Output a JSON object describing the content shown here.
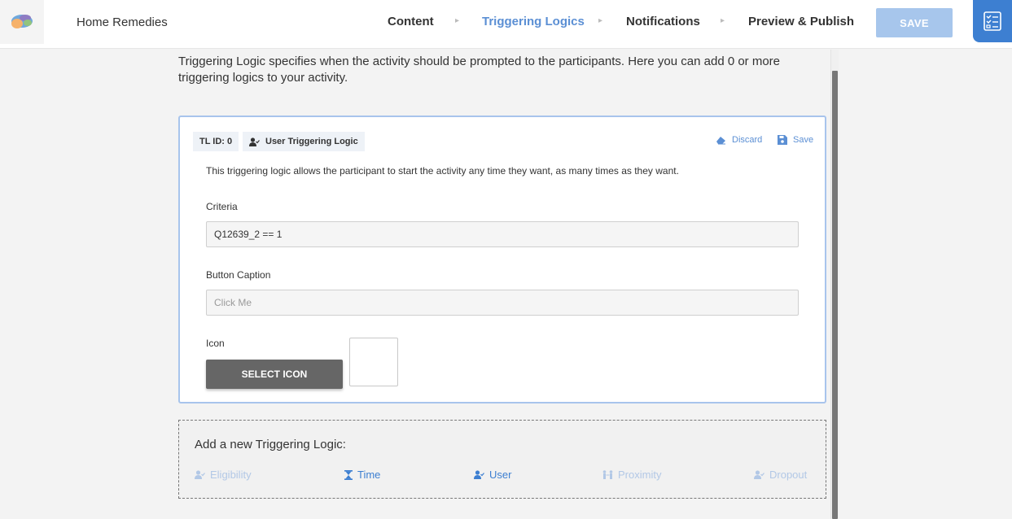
{
  "header": {
    "activity_title": "Home Remedies",
    "steps": [
      {
        "label": "Content",
        "active": false
      },
      {
        "label": "Triggering Logics",
        "active": true
      },
      {
        "label": "Notifications",
        "active": false
      },
      {
        "label": "Preview & Publish",
        "active": false
      }
    ],
    "save_label": "SAVE",
    "colors": {
      "accent": "#3d7fd1",
      "active_step": "#5b8fd4",
      "save_disabled": "#a7c6ec"
    }
  },
  "intro_text": "Triggering Logic specifies when the activity should be prompted to the participants. Here you can add 0 or more triggering logics to your activity.",
  "triggering_logic": {
    "id_label": "TL ID: 0",
    "type_label": "User Triggering Logic",
    "type_icon": "user-check-icon",
    "discard_label": "Discard",
    "save_label": "Save",
    "description": "This triggering logic allows the participant to start the activity any time they want, as many times as they want.",
    "criteria_label": "Criteria",
    "criteria_value": "Q12639_2 == 1",
    "button_caption_label": "Button Caption",
    "button_caption_placeholder": "Click Me",
    "icon_label": "Icon",
    "select_icon_label": "SELECT ICON"
  },
  "add_new": {
    "title": "Add a new Triggering Logic:",
    "options": [
      {
        "label": "Eligibility",
        "icon": "user-check-icon",
        "enabled": false
      },
      {
        "label": "Time",
        "icon": "hourglass-icon",
        "enabled": true
      },
      {
        "label": "User",
        "icon": "user-check-icon",
        "enabled": true
      },
      {
        "label": "Proximity",
        "icon": "proximity-icon",
        "enabled": false
      },
      {
        "label": "Dropout",
        "icon": "user-check-icon",
        "enabled": false
      }
    ]
  }
}
